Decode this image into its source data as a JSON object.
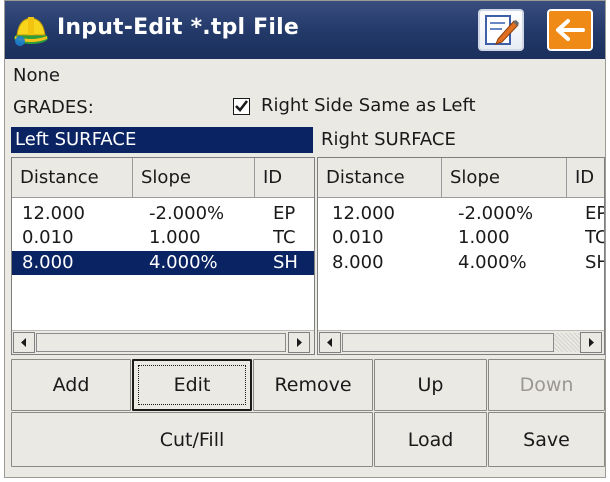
{
  "window": {
    "title": "Input-Edit *.tpl File",
    "app_icon": "hardhat-app-icon",
    "edit_icon": "edit-note-icon",
    "back_icon": "back-arrow-icon"
  },
  "header": {
    "template_name": "None",
    "grades_label": "GRADES:",
    "same_as_left": {
      "label": "Right Side Same as Left",
      "checked": true
    }
  },
  "left": {
    "title": "Left SURFACE",
    "columns": [
      "Distance",
      "Slope",
      "ID"
    ],
    "rows": [
      {
        "distance": "12.000",
        "slope": "-2.000%",
        "id": "EP"
      },
      {
        "distance": "0.010",
        "slope": "1.000",
        "id": "TC"
      },
      {
        "distance": "8.000",
        "slope": "4.000%",
        "id": "SH",
        "selected": true
      }
    ]
  },
  "right": {
    "title": "Right SURFACE",
    "columns": [
      "Distance",
      "Slope",
      "ID"
    ],
    "rows": [
      {
        "distance": "12.000",
        "slope": "-2.000%",
        "id": "EP"
      },
      {
        "distance": "0.010",
        "slope": "1.000",
        "id": "TC"
      },
      {
        "distance": "8.000",
        "slope": "4.000%",
        "id": "SH"
      }
    ]
  },
  "buttons": {
    "add": "Add",
    "edit": "Edit",
    "remove": "Remove",
    "up": "Up",
    "down": "Down",
    "cut_fill": "Cut/Fill",
    "load": "Load",
    "save": "Save"
  },
  "colors": {
    "title_bar": "#233a6a",
    "selection": "#0a2463",
    "back_button": "#f08a17",
    "disabled_text": "#9a9890"
  }
}
